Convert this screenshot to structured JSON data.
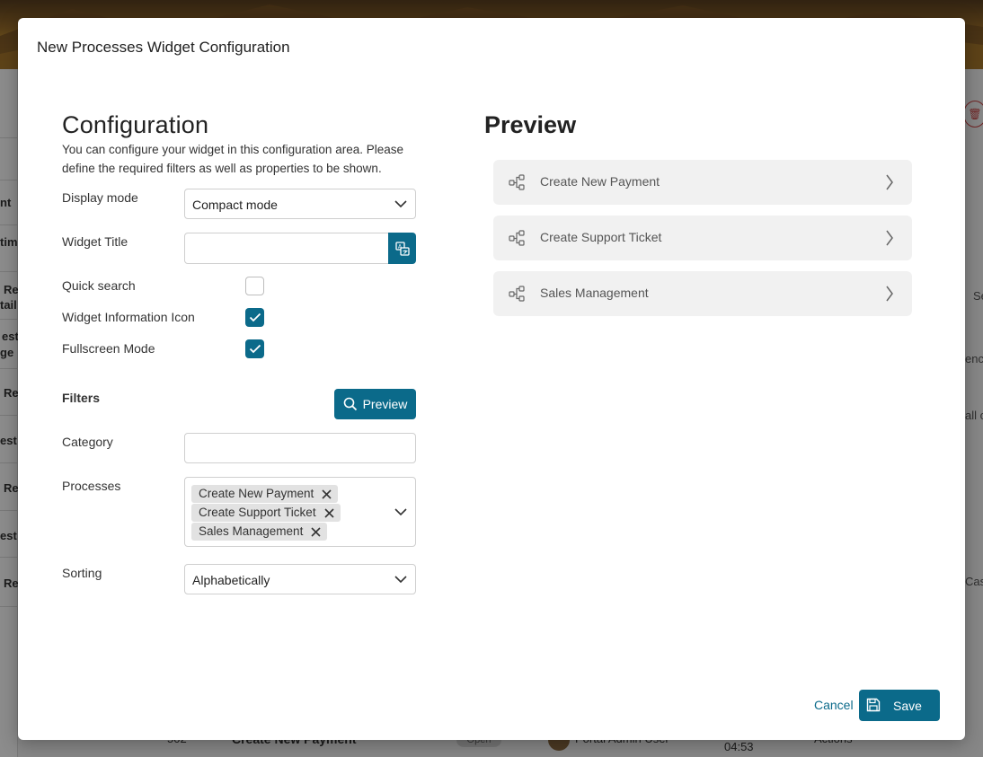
{
  "background": {
    "left_fragments": [
      "nt",
      "tim",
      "Re",
      "tail",
      "est",
      "ge",
      "Re",
      "est",
      "Re",
      "est",
      "Re"
    ],
    "right_fragments": [
      "Se",
      "enc",
      "all c",
      "Cas"
    ],
    "bottom_row": {
      "id": "502",
      "title": "Create New Payment",
      "status": "Open",
      "user": "Portal Admin User",
      "time": "04:53",
      "actions": "Actions"
    }
  },
  "modal": {
    "title": "New Processes Widget Configuration",
    "configuration": {
      "heading": "Configuration",
      "description": "You can configure your widget in this configuration area. Please define the required filters as well as properties to be shown.",
      "display_mode": {
        "label": "Display mode",
        "value": "Compact mode"
      },
      "widget_title": {
        "label": "Widget Title",
        "value": ""
      },
      "quick_search": {
        "label": "Quick search",
        "checked": false
      },
      "widget_info_icon": {
        "label": "Widget Information Icon",
        "checked": true
      },
      "fullscreen_mode": {
        "label": "Fullscreen Mode",
        "checked": true
      },
      "filters": {
        "label": "Filters",
        "preview_button": "Preview",
        "category": {
          "label": "Category",
          "value": ""
        },
        "processes": {
          "label": "Processes",
          "selected": [
            "Create New Payment",
            "Create Support Ticket",
            "Sales Management"
          ]
        },
        "sorting": {
          "label": "Sorting",
          "value": "Alphabetically"
        }
      }
    },
    "preview": {
      "heading": "Preview",
      "items": [
        "Create New Payment",
        "Create Support Ticket",
        "Sales Management"
      ]
    },
    "footer": {
      "cancel": "Cancel",
      "save": "Save"
    }
  },
  "colors": {
    "primary": "#0b6a8a",
    "chip_bg": "#e2e2e2",
    "preview_item_bg": "#f1f1f1"
  },
  "icons": {
    "translate": "translate-icon",
    "search": "search-icon",
    "check": "check-icon",
    "chevron_down": "chevron-down-icon",
    "chevron_right": "chevron-right-icon",
    "close": "close-icon",
    "process": "process-icon",
    "save": "floppy-disk-icon"
  }
}
